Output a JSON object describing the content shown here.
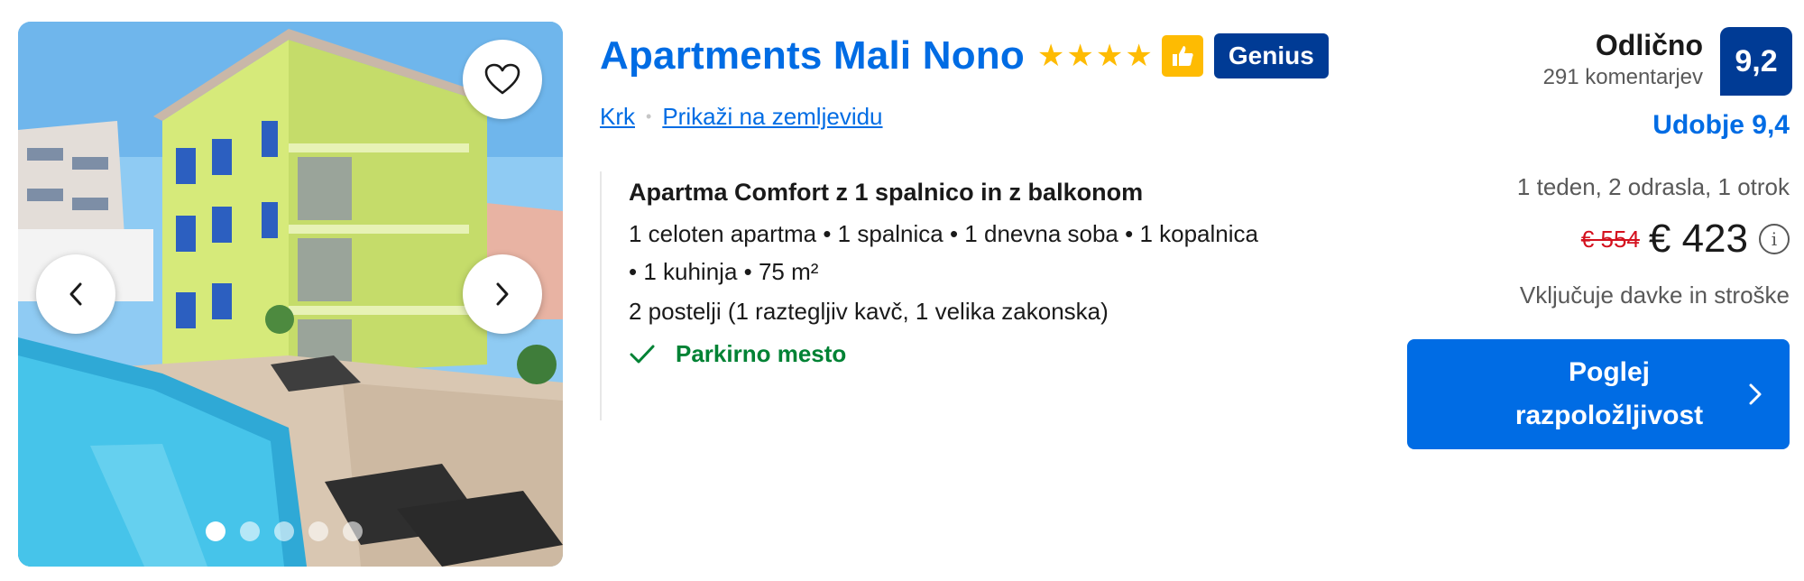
{
  "listing": {
    "name": "Apartments Mali Nono",
    "star_count": 4,
    "genius_label": "Genius",
    "location": "Krk",
    "map_link": "Prikaži na zemljevidu"
  },
  "photo": {
    "icon": "heart-icon",
    "prev_icon": "chevron-left-icon",
    "next_icon": "chevron-right-icon",
    "slide_count": 5,
    "active_slide": 1
  },
  "room": {
    "title": "Apartma Comfort z 1 spalnico in z balkonom",
    "features_line1": "1 celoten apartma • 1 spalnica • 1 dnevna soba • 1 kopalnica",
    "features_line2": "• 1 kuhinja • 75 m²",
    "beds": "2 postelji (1 raztegljiv kavč, 1 velika zakonska)",
    "parking": "Parkirno mesto"
  },
  "review": {
    "word": "Odlično",
    "count": "291 komentarjev",
    "score": "9,2",
    "comfort": "Udobje 9,4"
  },
  "pricing": {
    "stay": "1 teden, 2 odrasla, 1 otrok",
    "old_price": "€ 554",
    "new_price": "€ 423",
    "taxes": "Vključuje davke in stroške"
  },
  "cta": {
    "line1": "Poglej",
    "line2": "razpoložljivost"
  },
  "colors": {
    "link_blue": "#006ce4",
    "dark_blue": "#003b95",
    "star_yellow": "#febb02",
    "green": "#008234",
    "price_red": "#d4111e"
  }
}
